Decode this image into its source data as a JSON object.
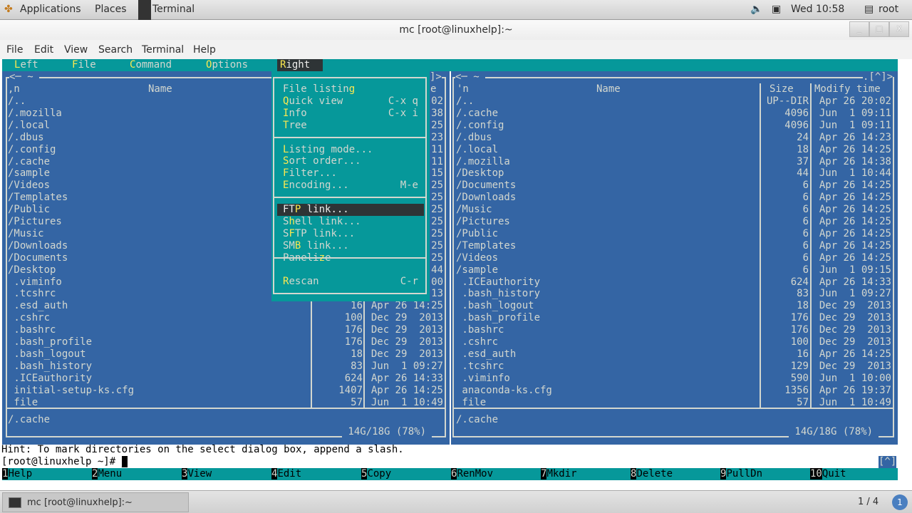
{
  "top_panel": {
    "applications": "Applications",
    "places": "Places",
    "terminal": "Terminal",
    "clock": "Wed 10:58",
    "user": "root"
  },
  "window": {
    "title": "mc [root@linuxhelp]:~",
    "minimize": "_",
    "maximize": "□",
    "close": "X",
    "menu": [
      "File",
      "Edit",
      "View",
      "Search",
      "Terminal",
      "Help"
    ]
  },
  "mc": {
    "menubar": [
      {
        "pre": "",
        "hot": "L",
        "post": "eft"
      },
      {
        "pre": "",
        "hot": "F",
        "post": "ile"
      },
      {
        "pre": "",
        "hot": "C",
        "post": "ommand"
      },
      {
        "pre": "",
        "hot": "O",
        "post": "ptions"
      },
      {
        "pre": "",
        "hot": "R",
        "post": "ight",
        "active": true
      }
    ],
    "left_panel": {
      "top_left": "<─ ~ ",
      "top_right": "]>",
      "sort_indicator": ",n",
      "name_header": "Name",
      "hidden_header_tail": "e",
      "rows": [
        {
          "name": "/..",
          "size": "",
          "time": "02"
        },
        {
          "name": "/.mozilla",
          "size": "",
          "time": "38"
        },
        {
          "name": "/.local",
          "size": "",
          "time": "25"
        },
        {
          "name": "/.dbus",
          "size": "",
          "time": "23"
        },
        {
          "name": "/.config",
          "size": "",
          "time": "11"
        },
        {
          "name": "/.cache",
          "size": "",
          "time": "11"
        },
        {
          "name": "/sample",
          "size": "",
          "time": "15"
        },
        {
          "name": "/Videos",
          "size": "",
          "time": "25"
        },
        {
          "name": "/Templates",
          "size": "",
          "time": "25"
        },
        {
          "name": "/Public",
          "size": "",
          "time": "25"
        },
        {
          "name": "/Pictures",
          "size": "",
          "time": "25"
        },
        {
          "name": "/Music",
          "size": "",
          "time": "25"
        },
        {
          "name": "/Downloads",
          "size": "",
          "time": "25"
        },
        {
          "name": "/Documents",
          "size": "",
          "time": "25"
        },
        {
          "name": "/Desktop",
          "size": "",
          "time": "44"
        },
        {
          "name": " .viminfo",
          "size": "",
          "time": "00"
        },
        {
          "name": " .tcshrc",
          "size": "",
          "time": "13"
        },
        {
          "name": " .esd_auth",
          "size": "16",
          "time": "Apr 26 14:25"
        },
        {
          "name": " .cshrc",
          "size": "100",
          "time": "Dec 29  2013"
        },
        {
          "name": " .bashrc",
          "size": "176",
          "time": "Dec 29  2013"
        },
        {
          "name": " .bash_profile",
          "size": "176",
          "time": "Dec 29  2013"
        },
        {
          "name": " .bash_logout",
          "size": "18",
          "time": "Dec 29  2013"
        },
        {
          "name": " .bash_history",
          "size": "83",
          "time": "Jun  1 09:27"
        },
        {
          "name": " .ICEauthority",
          "size": "624",
          "time": "Apr 26 14:33"
        },
        {
          "name": " initial-setup-ks.cfg",
          "size": "1407",
          "time": "Apr 26 14:25"
        },
        {
          "name": " file",
          "size": "57",
          "time": "Jun  1 10:49"
        }
      ],
      "current": "/.cache",
      "disk": " 14G/18G (78%) "
    },
    "right_panel": {
      "top_left": "<─ ~ ",
      "top_right": ".[^]>",
      "sort_indicator": "'n",
      "name_header": "Name",
      "size_header": "Size",
      "time_header": "Modify time",
      "rows": [
        {
          "name": "/..",
          "size": "UP--DIR",
          "time": "Apr 26 20:02"
        },
        {
          "name": "/.cache",
          "size": "4096",
          "time": "Jun  1 09:11"
        },
        {
          "name": "/.config",
          "size": "4096",
          "time": "Jun  1 09:11"
        },
        {
          "name": "/.dbus",
          "size": "24",
          "time": "Apr 26 14:23"
        },
        {
          "name": "/.local",
          "size": "18",
          "time": "Apr 26 14:25"
        },
        {
          "name": "/.mozilla",
          "size": "37",
          "time": "Apr 26 14:38"
        },
        {
          "name": "/Desktop",
          "size": "44",
          "time": "Jun  1 10:44"
        },
        {
          "name": "/Documents",
          "size": "6",
          "time": "Apr 26 14:25"
        },
        {
          "name": "/Downloads",
          "size": "6",
          "time": "Apr 26 14:25"
        },
        {
          "name": "/Music",
          "size": "6",
          "time": "Apr 26 14:25"
        },
        {
          "name": "/Pictures",
          "size": "6",
          "time": "Apr 26 14:25"
        },
        {
          "name": "/Public",
          "size": "6",
          "time": "Apr 26 14:25"
        },
        {
          "name": "/Templates",
          "size": "6",
          "time": "Apr 26 14:25"
        },
        {
          "name": "/Videos",
          "size": "6",
          "time": "Apr 26 14:25"
        },
        {
          "name": "/sample",
          "size": "6",
          "time": "Jun  1 09:15"
        },
        {
          "name": " .ICEauthority",
          "size": "624",
          "time": "Apr 26 14:33"
        },
        {
          "name": " .bash_history",
          "size": "83",
          "time": "Jun  1 09:27"
        },
        {
          "name": " .bash_logout",
          "size": "18",
          "time": "Dec 29  2013"
        },
        {
          "name": " .bash_profile",
          "size": "176",
          "time": "Dec 29  2013"
        },
        {
          "name": " .bashrc",
          "size": "176",
          "time": "Dec 29  2013"
        },
        {
          "name": " .cshrc",
          "size": "100",
          "time": "Dec 29  2013"
        },
        {
          "name": " .esd_auth",
          "size": "16",
          "time": "Apr 26 14:25"
        },
        {
          "name": " .tcshrc",
          "size": "129",
          "time": "Dec 29  2013"
        },
        {
          "name": " .viminfo",
          "size": "590",
          "time": "Jun  1 10:00"
        },
        {
          "name": " anaconda-ks.cfg",
          "size": "1356",
          "time": "Apr 26 19:37"
        },
        {
          "name": " file",
          "size": "57",
          "time": "Jun  1 10:49"
        }
      ],
      "current": "/.cache",
      "disk": " 14G/18G (78%) "
    },
    "right_menu": {
      "items": [
        {
          "pre": "File listin",
          "hot": "g",
          "post": "",
          "shortcut": "",
          "row": 0
        },
        {
          "pre": "",
          "hot": "Q",
          "post": "uick view",
          "shortcut": "C-x q",
          "row": 1
        },
        {
          "pre": "",
          "hot": "I",
          "post": "nfo",
          "shortcut": "C-x i",
          "row": 2
        },
        {
          "pre": "",
          "hot": "T",
          "post": "ree",
          "shortcut": "",
          "row": 3
        },
        {
          "pre": "",
          "hot": "L",
          "post": "isting mode...",
          "shortcut": "",
          "row": 5
        },
        {
          "pre": "",
          "hot": "S",
          "post": "ort order...",
          "shortcut": "",
          "row": 6
        },
        {
          "pre": "",
          "hot": "F",
          "post": "ilter...",
          "shortcut": "",
          "row": 7
        },
        {
          "pre": "",
          "hot": "E",
          "post": "ncoding...",
          "shortcut": "M-e",
          "row": 8
        },
        {
          "pre": "FT",
          "hot": "P",
          "post": " link...",
          "shortcut": "",
          "row": 10,
          "selected": true
        },
        {
          "pre": "S",
          "hot": "h",
          "post": "ell link...",
          "shortcut": "",
          "row": 11
        },
        {
          "pre": "S",
          "hot": "F",
          "post": "TP link...",
          "shortcut": "",
          "row": 12
        },
        {
          "pre": "SM",
          "hot": "B",
          "post": " link...",
          "shortcut": "",
          "row": 13
        },
        {
          "pre": "Paneli",
          "hot": "z",
          "post": "e",
          "shortcut": "",
          "row": 14
        },
        {
          "pre": "",
          "hot": "R",
          "post": "escan",
          "shortcut": "C-r",
          "row": 16
        }
      ]
    },
    "hint": "Hint: To mark directories on the select dialog box, append a slash.",
    "prompt": "[root@linuxhelp ~]# ",
    "prompt_scroll": "[^]",
    "fkeys": [
      {
        "n": "1",
        "label": "Help"
      },
      {
        "n": "2",
        "label": "Menu"
      },
      {
        "n": "3",
        "label": "View"
      },
      {
        "n": "4",
        "label": "Edit"
      },
      {
        "n": "5",
        "label": "Copy"
      },
      {
        "n": "6",
        "label": "RenMov"
      },
      {
        "n": "7",
        "label": "Mkdir"
      },
      {
        "n": "8",
        "label": "Delete"
      },
      {
        "n": "9",
        "label": "PullDn"
      },
      {
        "n": "10",
        "label": "Quit"
      }
    ]
  },
  "taskbar": {
    "window_button": "mc [root@linuxhelp]:~",
    "workspace": "1 / 4",
    "notifications": "1"
  },
  "colors": {
    "panel": "#3465a4",
    "menubar": "#06989a",
    "hotkey": "#fce94f",
    "text": "#d3d7cf"
  }
}
